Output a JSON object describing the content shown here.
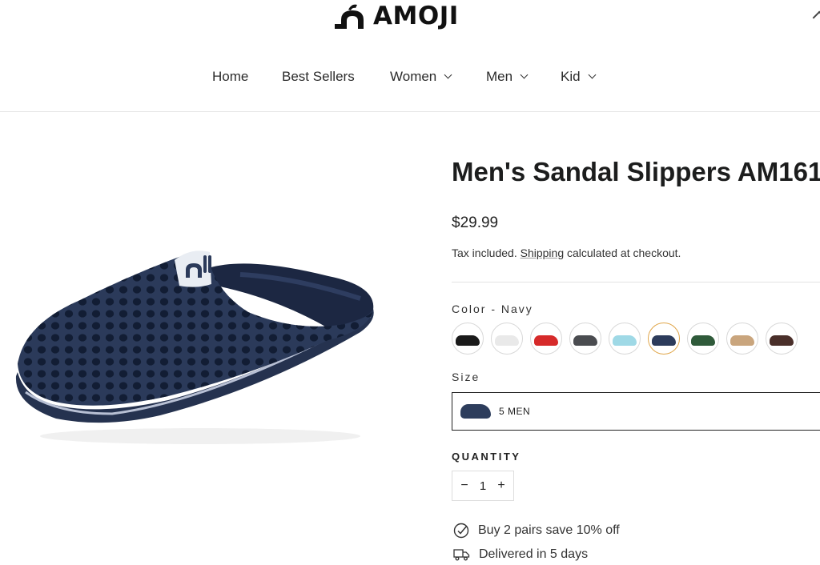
{
  "header": {
    "logo_text": "AMOJI",
    "nav": [
      {
        "label": "Home",
        "has_dropdown": false
      },
      {
        "label": "Best Sellers",
        "has_dropdown": false
      },
      {
        "label": "Women",
        "has_dropdown": true
      },
      {
        "label": "Men",
        "has_dropdown": true
      },
      {
        "label": "Kid",
        "has_dropdown": true
      }
    ]
  },
  "product": {
    "title": "Men's Sandal Slippers AM161",
    "price": "$29.99",
    "tax_note_prefix": "Tax included. ",
    "tax_note_link": "Shipping",
    "tax_note_suffix": " calculated at checkout.",
    "color_label": "Color - Navy",
    "swatches": [
      {
        "name": "Black",
        "color": "#1a1a1a"
      },
      {
        "name": "White",
        "color": "#e9e9e9"
      },
      {
        "name": "Red",
        "color": "#d62a2a"
      },
      {
        "name": "Gray",
        "color": "#4a4c50"
      },
      {
        "name": "Light Blue",
        "color": "#9fd9e6"
      },
      {
        "name": "Navy",
        "color": "#2c3b5b",
        "selected": true
      },
      {
        "name": "Green",
        "color": "#2f5a3a"
      },
      {
        "name": "Khaki",
        "color": "#c9a57d"
      },
      {
        "name": "Brown",
        "color": "#4a2f2a"
      }
    ],
    "size_label": "Size",
    "size_value": "5 MEN",
    "quantity_label": "QUANTITY",
    "quantity_value": "1",
    "qty_minus": "−",
    "qty_plus": "+",
    "features": [
      {
        "icon": "check-circle-icon",
        "text": "Buy 2 pairs save 10% off"
      },
      {
        "icon": "truck-icon",
        "text": "Delivered in 5 days"
      }
    ]
  },
  "colors": {
    "navy_shoe": "#2b3a5a",
    "accent_selected": "#e0a64a"
  }
}
